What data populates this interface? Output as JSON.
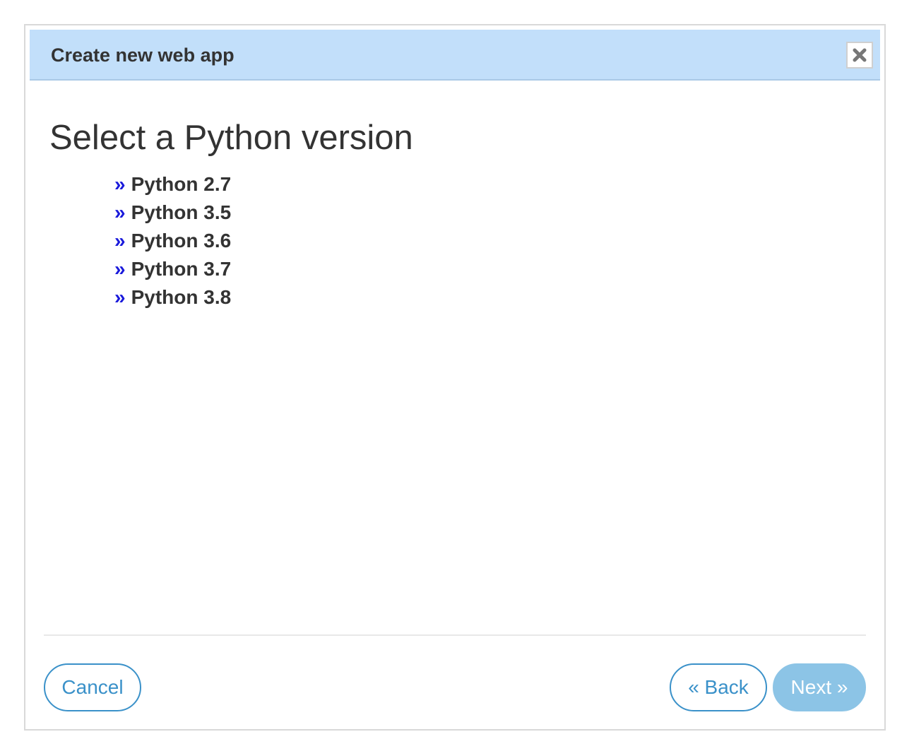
{
  "dialog": {
    "title": "Create new web app",
    "close_glyph": "✖",
    "close_icon": "close-icon"
  },
  "main": {
    "heading": "Select a Python version",
    "bullet": "»",
    "versions": [
      {
        "label": "Python 2.7"
      },
      {
        "label": "Python 3.5"
      },
      {
        "label": "Python 3.6"
      },
      {
        "label": "Python 3.7"
      },
      {
        "label": "Python 3.8"
      }
    ]
  },
  "footer": {
    "cancel_label": "Cancel",
    "back_label": "« Back",
    "next_label": "Next »"
  },
  "colors": {
    "title_bar_bg": "#c2dffa",
    "bullet": "#1a1adb",
    "button_outline": "#3a91c9",
    "next_button_bg": "#8cc4e6"
  }
}
